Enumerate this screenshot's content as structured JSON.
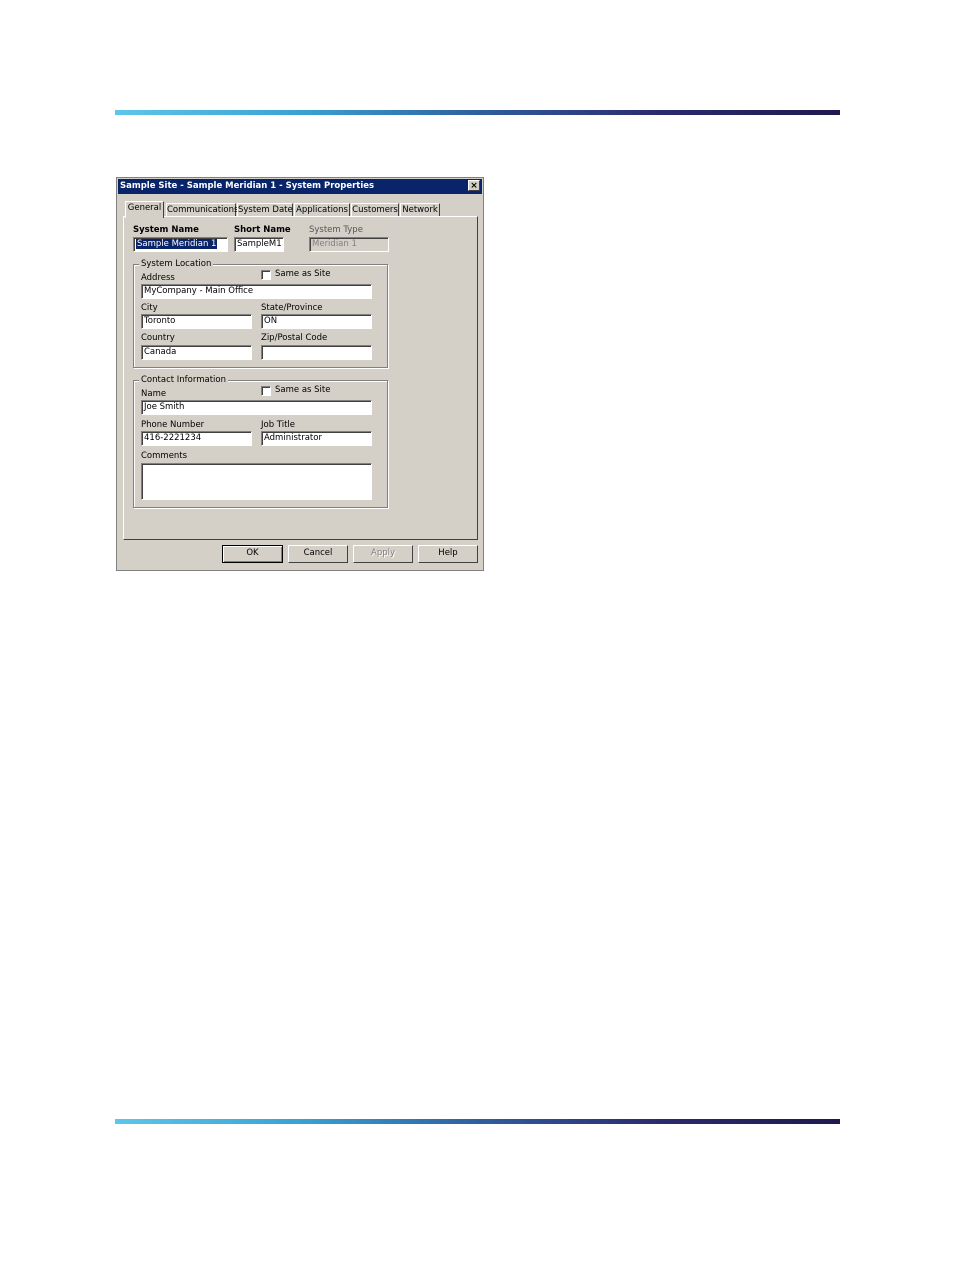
{
  "window": {
    "title": "Sample Site - Sample Meridian 1 - System Properties",
    "close_glyph": "×"
  },
  "tabs": [
    {
      "label": "General",
      "active": true
    },
    {
      "label": "Communications",
      "active": false
    },
    {
      "label": "System Date",
      "active": false
    },
    {
      "label": "Applications",
      "active": false
    },
    {
      "label": "Customers",
      "active": false
    },
    {
      "label": "Network",
      "active": false
    }
  ],
  "general": {
    "system_name_label": "System Name",
    "system_name_value": "Sample Meridian 1",
    "short_name_label": "Short Name",
    "short_name_value": "SampleM1",
    "system_type_label": "System Type",
    "system_type_value": "Meridian 1"
  },
  "location": {
    "group_title": "System Location",
    "same_as_site_label": "Same as Site",
    "address_label": "Address",
    "address_value": "MyCompany - Main Office",
    "city_label": "City",
    "city_value": "Toronto",
    "state_label": "State/Province",
    "state_value": "ON",
    "country_label": "Country",
    "country_value": "Canada",
    "zip_label": "Zip/Postal Code",
    "zip_value": ""
  },
  "contact": {
    "group_title": "Contact Information",
    "same_as_site_label": "Same as Site",
    "name_label": "Name",
    "name_value": "Joe Smith",
    "phone_label": "Phone Number",
    "phone_value": "416-2221234",
    "job_title_label": "Job Title",
    "job_title_value": "Administrator",
    "comments_label": "Comments",
    "comments_value": ""
  },
  "buttons": {
    "ok": "OK",
    "cancel": "Cancel",
    "apply": "Apply",
    "help": "Help"
  },
  "colors": {
    "titlebar": "#0a246a",
    "dialog_face": "#d4d0c8"
  }
}
